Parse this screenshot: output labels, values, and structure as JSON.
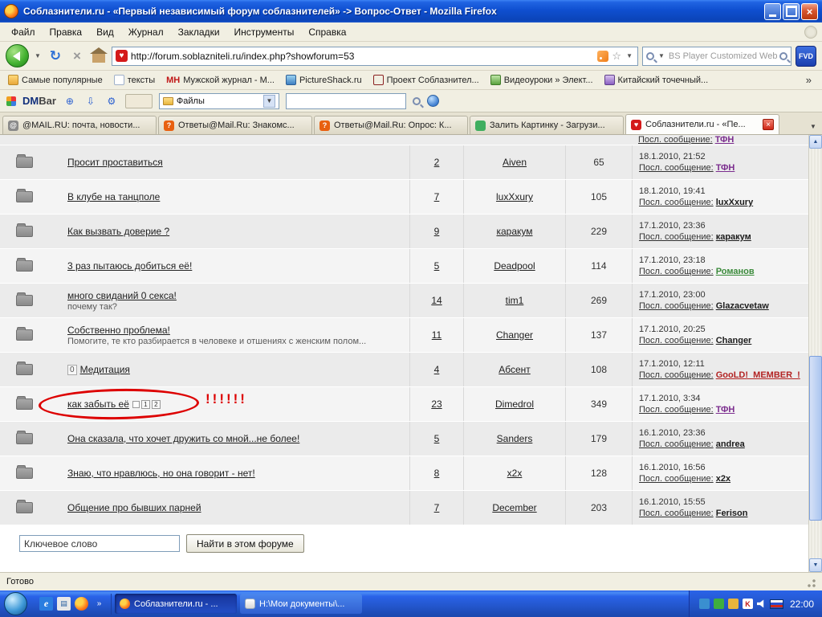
{
  "window": {
    "title": "Соблазнители.ru - «Первый независимый форум соблазнителей» -> Вопрос-Ответ - Mozilla Firefox"
  },
  "menubar": {
    "items": [
      "Файл",
      "Правка",
      "Вид",
      "Журнал",
      "Закладки",
      "Инструменты",
      "Справка"
    ]
  },
  "navbar": {
    "url": "http://forum.soblazniteli.ru/index.php?showforum=53",
    "search_text": "BS Player Customized Web S",
    "fvd_label": "FVD"
  },
  "bookmarks": {
    "items": [
      {
        "label": "Самые популярные"
      },
      {
        "label": "тексты"
      },
      {
        "label": "Мужской журнал - М...",
        "icon_text": "МН"
      },
      {
        "label": "PictureShack.ru"
      },
      {
        "label": "Проект Соблазнител..."
      },
      {
        "label": "Видеоуроки » Элект..."
      },
      {
        "label": "Китайский точечный..."
      }
    ],
    "overflow": "»"
  },
  "dmbar": {
    "logo_dm": "DM",
    "logo_bar": "Bar",
    "files_select": "Файлы"
  },
  "tabs": [
    {
      "label": "@MAIL.RU: почта, новости..."
    },
    {
      "label": "Ответы@Mail.Ru: Знакомс..."
    },
    {
      "label": "Ответы@Mail.Ru: Опрос: К..."
    },
    {
      "label": "Залить Картинку - Загрузи..."
    },
    {
      "label": "Соблазнители.ru - «Пе...",
      "active": true
    }
  ],
  "forum": {
    "last_label": "Посл. сообщение:",
    "partial_top": {
      "last_label": "Посл. сообщение:",
      "last_author": "ТФН"
    },
    "rows": [
      {
        "title": "Просит проставиться",
        "replies": "2",
        "author": "Aiven",
        "views": "65",
        "last_date": "18.1.2010, 21:52",
        "last_author": "ТФН",
        "last_author_color": "#7b2d8e"
      },
      {
        "title": "В клубе на танцполе",
        "replies": "7",
        "author": "luxXxury",
        "views": "105",
        "last_date": "18.1.2010, 19:41",
        "last_author": "luxXxury",
        "last_author_color": "#1c1c1c"
      },
      {
        "title": "Как вызвать доверие ?",
        "replies": "9",
        "author": "каракум",
        "views": "229",
        "last_date": "17.1.2010, 23:36",
        "last_author": "каракум",
        "last_author_color": "#1c1c1c"
      },
      {
        "title": "3 раз пытаюсь добиться её!",
        "replies": "5",
        "author": "Deadpool",
        "views": "114",
        "last_date": "17.1.2010, 23:18",
        "last_author": "Романов",
        "last_author_color": "#3a8a3a"
      },
      {
        "title": "много свиданий 0 секса!",
        "subtitle": "почему так?",
        "replies": "14",
        "author": "tim1",
        "views": "269",
        "last_date": "17.1.2010, 23:00",
        "last_author": "Glazacvetaw",
        "last_author_color": "#1c1c1c"
      },
      {
        "title": "Собственно проблема!",
        "subtitle": "Помогите, те кто разбирается в человеке и отшениях с женским полом...",
        "replies": "11",
        "author": "Changer",
        "views": "137",
        "last_date": "17.1.2010, 20:25",
        "last_author": "Changer",
        "last_author_color": "#1c1c1c"
      },
      {
        "title": "Медитация",
        "prefix": "0",
        "replies": "4",
        "author": "Абсент",
        "views": "108",
        "last_date": "17.1.2010, 12:11",
        "last_author": "GooLD!_MEMBER_!",
        "last_author_color": "#b22222"
      },
      {
        "title": "как забыть её",
        "pages": [
          "1",
          "2"
        ],
        "replies": "23",
        "author": "Dimedrol",
        "views": "349",
        "last_date": "17.1.2010, 3:34",
        "last_author": "ТФН",
        "last_author_color": "#7b2d8e"
      },
      {
        "title": "Она сказала, что хочет дружить со мной...не более!",
        "replies": "5",
        "author": "Sanders",
        "views": "179",
        "last_date": "16.1.2010, 23:36",
        "last_author": "andrea",
        "last_author_color": "#1c1c1c"
      },
      {
        "title": "Знаю, что нравлюсь, но она говорит - нет!",
        "replies": "8",
        "author": "x2x",
        "views": "128",
        "last_date": "16.1.2010, 16:56",
        "last_author": "x2x",
        "last_author_color": "#1c1c1c"
      },
      {
        "title": "Общение про бывших парней",
        "replies": "7",
        "author": "December",
        "views": "203",
        "last_date": "16.1.2010, 15:55",
        "last_author": "Ferison",
        "last_author_color": "#1c1c1c"
      }
    ],
    "search": {
      "keyword_value": "Ключевое слово",
      "button_label": "Найти в этом форуме"
    }
  },
  "annotation": {
    "exclamations": "!!!!!!"
  },
  "statusbar": {
    "text": "Готово"
  },
  "taskbar": {
    "tasks": [
      {
        "label": "Соблазнители.ru - ..."
      },
      {
        "label": "H:\\Мои документы\\..."
      }
    ],
    "clock": "22:00"
  }
}
